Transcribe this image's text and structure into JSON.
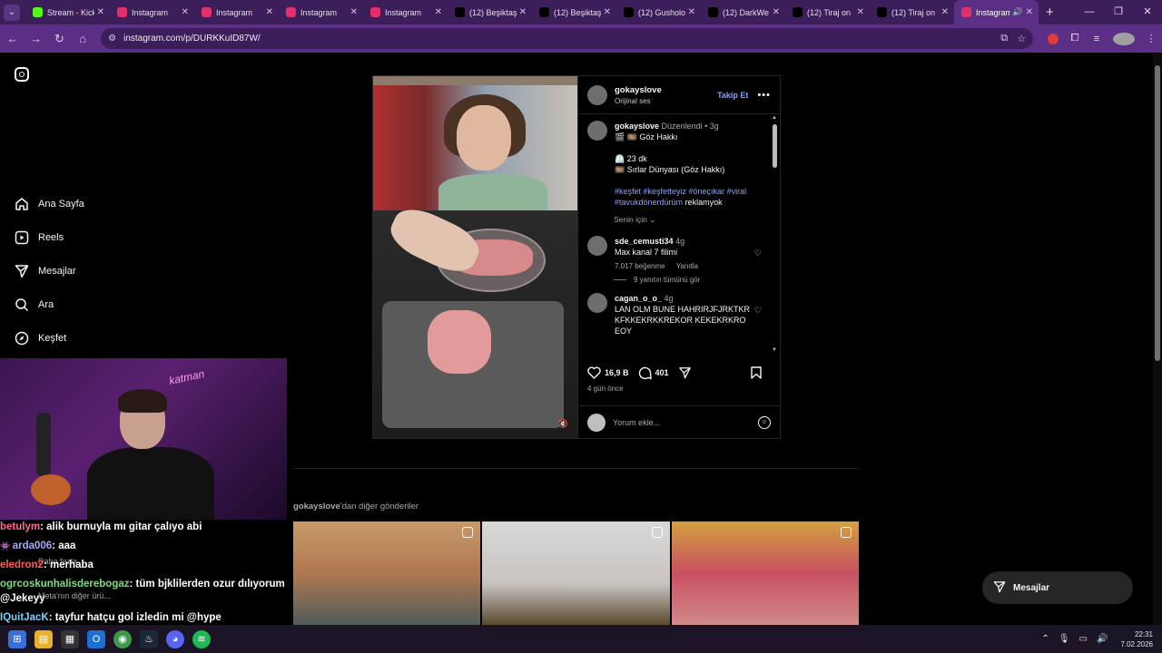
{
  "browser": {
    "tabs": [
      {
        "title": "Stream - Kick",
        "favicon_color": "#53fc18"
      },
      {
        "title": "Instagram",
        "favicon_color": "#e1306c"
      },
      {
        "title": "Instagram",
        "favicon_color": "#e1306c"
      },
      {
        "title": "Instagram",
        "favicon_color": "#e1306c"
      },
      {
        "title": "Instagram",
        "favicon_color": "#e1306c"
      },
      {
        "title": "(12) Beşiktaş",
        "favicon_color": "#000000"
      },
      {
        "title": "(12) Beşiktaş",
        "favicon_color": "#000000"
      },
      {
        "title": "(12) Gusholo",
        "favicon_color": "#000000"
      },
      {
        "title": "(12) DarkWe",
        "favicon_color": "#000000"
      },
      {
        "title": "(12) Tiraj on",
        "favicon_color": "#000000"
      },
      {
        "title": "(12) Tiraj on",
        "favicon_color": "#000000"
      },
      {
        "title": "Instagram",
        "favicon_color": "#e1306c",
        "active": true
      }
    ],
    "new_tab_label": "+",
    "url": "instagram.com/p/DURKKuID87W/",
    "window_controls": {
      "minimize": "—",
      "restore": "❐",
      "close": "✕"
    }
  },
  "sidebar": {
    "items": [
      {
        "label": "Ana Sayfa",
        "icon": "home-icon"
      },
      {
        "label": "Reels",
        "icon": "reels-icon"
      },
      {
        "label": "Mesajlar",
        "icon": "send-icon"
      },
      {
        "label": "Ara",
        "icon": "search-icon"
      },
      {
        "label": "Keşfet",
        "icon": "compass-icon"
      }
    ]
  },
  "post": {
    "author": "gokayslove",
    "audio": "Orijinal ses",
    "follow_label": "Takip Et",
    "caption": {
      "author": "gokayslove",
      "edited": "Düzenlendi",
      "age": "3g",
      "line1": "🎬 🎞️ Göz Hakkı",
      "line2": "⏲️ 23 dk",
      "line3": "🎞️ Sırlar Dünyası (Göz Hakkı)",
      "hashtags": "#keşfet #keşfetteyiz #öneçıkar #viral #tavukdönerdürüm",
      "tail": "reklamyok"
    },
    "for_you": "Senin için",
    "comments": [
      {
        "author": "sde_cemusti34",
        "age": "4g",
        "text": "Max kanal 7 filimi",
        "likes": "7.017 beğenme",
        "reply_label": "Yanıtla",
        "view_replies": "9 yanıtın tümünü gör"
      },
      {
        "author": "cagan_o_o_",
        "age": "4g",
        "text": "LAN OLM BUNE HAHRIRJFJRKTKRKFKKEKRKKREKOR KEKEKRKROEOY"
      }
    ],
    "likes": "16,9 B",
    "comment_count": "401",
    "posted": "4 gün önce",
    "comment_placeholder": "Yorum ekle..."
  },
  "more_posts": {
    "author": "gokayslove",
    "suffix": "'dan diğer gönderiler"
  },
  "floating_messages": "Mesajlar",
  "stream_overlay": {
    "neon_sign": "katman",
    "chat": [
      {
        "user": "betulym",
        "message": ": alik burnuyla mı gitar çalıyo abi"
      },
      {
        "user": "arda006",
        "message": ": aaa"
      },
      {
        "user": "eledron2",
        "message": ": merhaba"
      },
      {
        "user": "ogrcoskunhalisderebogaz",
        "message": ": tüm bjklilerden ozur dılıyorum"
      },
      {
        "user": "@Jekeyy",
        "message": ""
      },
      {
        "user": "IQuitJacK",
        "message": ": tayfur hatçu gol izledin mi @hype"
      }
    ],
    "ghost_text_1": "Daha fazla",
    "ghost_text_2": "Meta'nın diğer ürü..."
  },
  "taskbar": {
    "time": "22:31",
    "date": "7.02.2026"
  }
}
